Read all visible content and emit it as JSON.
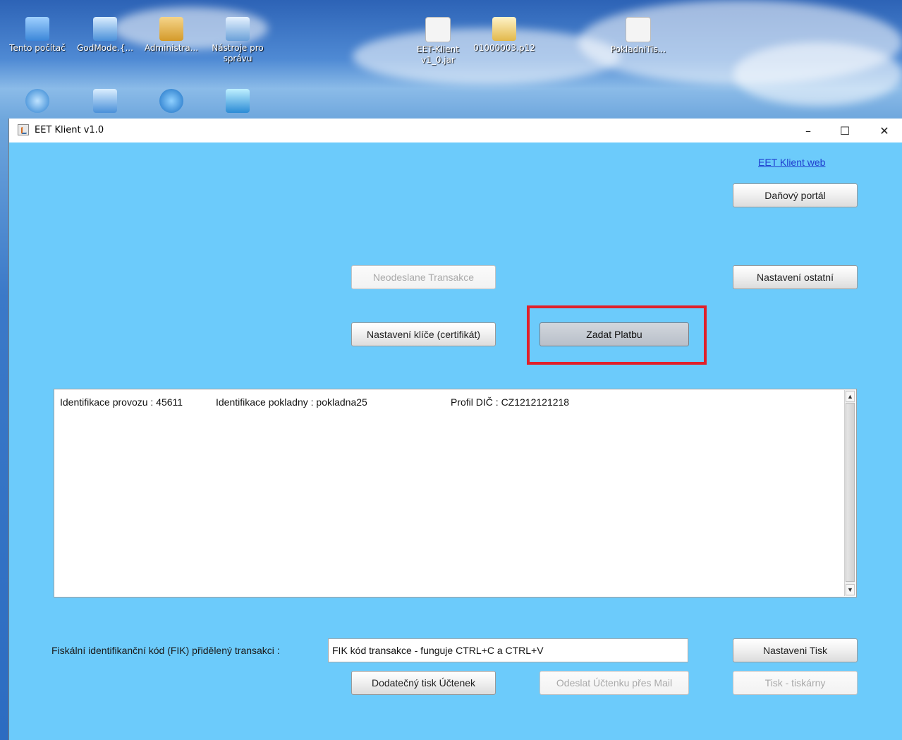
{
  "desktop": {
    "icons_row1": [
      {
        "label": "Tento počítač",
        "icon": "computer-icon",
        "color": "#5aa0e8"
      },
      {
        "label": "GodMode.{...",
        "icon": "control-panel-icon",
        "color": "#4a90d9"
      },
      {
        "label": "Administra...",
        "icon": "user-folder-icon",
        "color": "#e0b24a"
      },
      {
        "label": "Nástroje pro správu",
        "icon": "admin-tools-icon",
        "color": "#6aa0d8"
      },
      {
        "label": "EET-Klient v1_0.jar",
        "icon": "java-jar-icon",
        "color": "#f0f0f0"
      },
      {
        "label": "01000003.p12",
        "icon": "certificate-icon",
        "color": "#f2d27a"
      },
      {
        "label": "PokladniTis...",
        "icon": "java-jar-icon",
        "color": "#f0f0f0"
      }
    ],
    "icons_row2": [
      {
        "label": "",
        "icon": "network-icon",
        "color": "#4a9ae0"
      },
      {
        "label": "",
        "icon": "control-panel-icon",
        "color": "#4a90d9"
      },
      {
        "label": "",
        "icon": "internet-explorer-icon",
        "color": "#2a86d6"
      },
      {
        "label": "",
        "icon": "shield-settings-icon",
        "color": "#3aa0e0"
      }
    ]
  },
  "window": {
    "title": "EET Klient v1.0",
    "minimize": "–",
    "maximize": "☐",
    "close": "✕"
  },
  "main": {
    "web_link": "EET Klient web",
    "tax_portal_button": "Daňový portál",
    "unsent_transactions_button": "Neodeslane Transakce",
    "other_settings_button": "Nastavení ostatní",
    "key_settings_button": "Nastavení klíče (certifikát)",
    "enter_payment_button": "Zadat Platbu",
    "info": {
      "provoz": "Identifikace provozu : 45611",
      "pokladna": "Identifikace pokladny : pokladna25",
      "dic": "Profil DIČ : CZ1212121218"
    },
    "fik_label": "Fiskální identifikanční kód (FIK) přidělený transakci :",
    "fik_value": "FIK kód transakce - funguje CTRL+C a CTRL+V",
    "print_settings_button": "Nastaveni Tisk",
    "extra_print_button": "Dodatečný tisk Účtenek",
    "send_mail_button": "Odeslat Účtenku přes Mail",
    "printers_button": "Tisk - tiskárny"
  },
  "colors": {
    "window_bg": "#6ccbfb",
    "highlight": "#e0202a",
    "link": "#1f3fcf"
  }
}
